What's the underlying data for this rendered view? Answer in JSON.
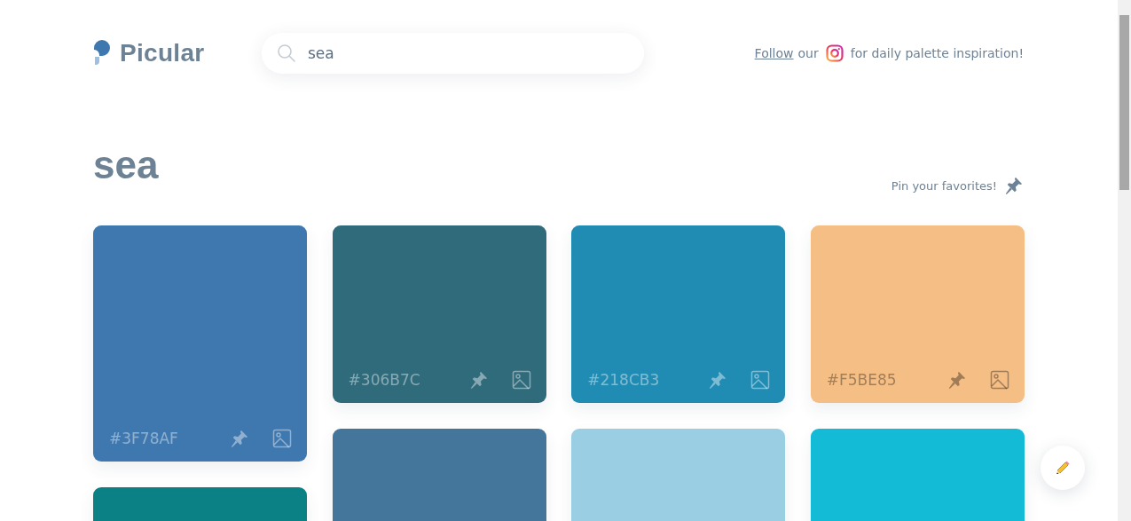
{
  "logo": {
    "text": "Picular"
  },
  "search": {
    "value": "sea"
  },
  "promo": {
    "link": "Follow",
    "text_before_icon": "our",
    "text_after_icon": "for daily palette inspiration!"
  },
  "heading": "sea",
  "pin_hint": "Pin your favorites!",
  "columns": [
    {
      "cards": [
        {
          "color": "#3f78af",
          "hex": "#3F78AF"
        },
        {
          "color": "#0b8185"
        }
      ]
    },
    {
      "cards": [
        {
          "color": "#306b7c",
          "hex": "#306B7C"
        },
        {
          "color": "#44759b"
        }
      ]
    },
    {
      "cards": [
        {
          "color": "#218cb3",
          "hex": "#218CB3"
        },
        {
          "color": "#9acfe3"
        }
      ]
    },
    {
      "cards": [
        {
          "color": "#f5be85",
          "hex": "#F5BE85"
        },
        {
          "color": "#14bbd6"
        }
      ]
    }
  ]
}
